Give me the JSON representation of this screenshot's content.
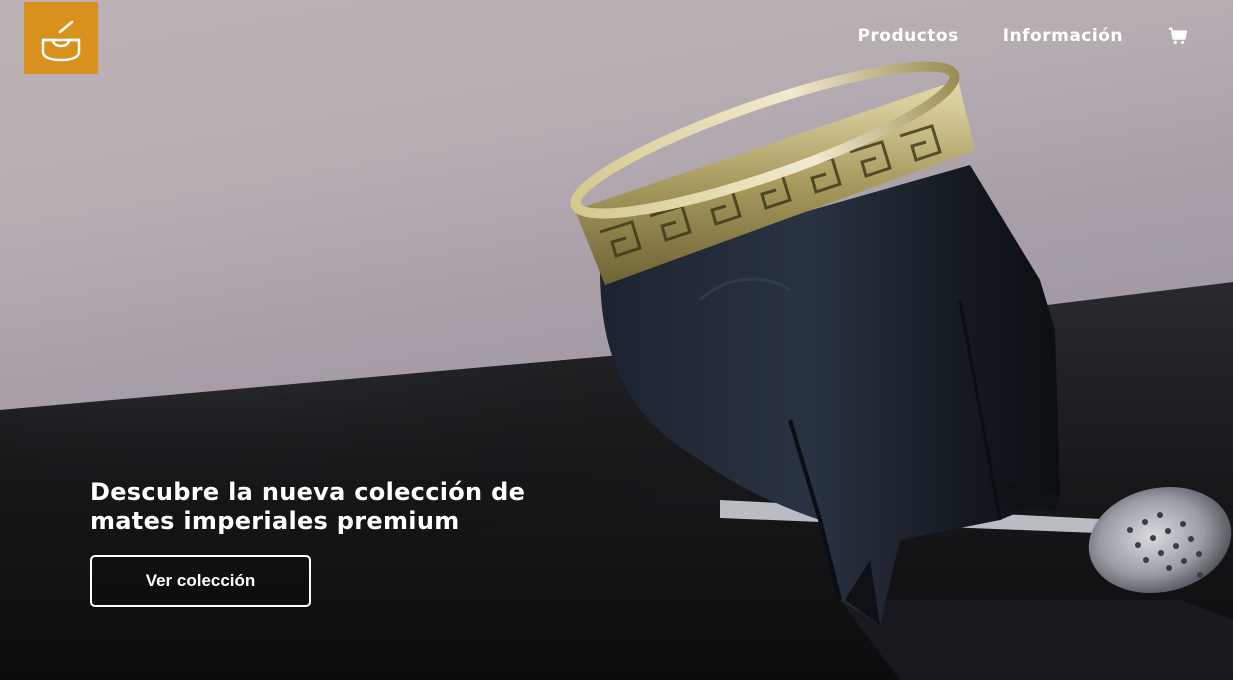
{
  "brand": {
    "logo_icon": "mate-cup-icon",
    "accent": "#d7911c"
  },
  "nav": {
    "items": [
      {
        "label": "Productos"
      },
      {
        "label": "Información"
      }
    ],
    "cart_icon": "shopping-cart-icon"
  },
  "hero": {
    "headline_line1": "Descubre la nueva colección de",
    "headline_line2": "mates imperiales premium",
    "cta_label": "Ver colección",
    "image_subject": "mate-with-bombilla-photo"
  }
}
